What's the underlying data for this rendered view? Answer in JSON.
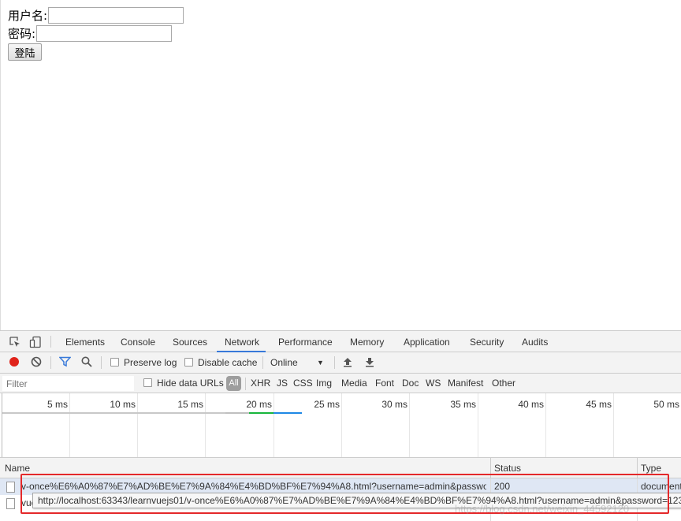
{
  "form": {
    "username_label": "用户名:",
    "username_value": "",
    "password_label": "密码:",
    "password_value": "",
    "login_button": "登陆"
  },
  "devtools": {
    "tabs": [
      "Elements",
      "Console",
      "Sources",
      "Network",
      "Performance",
      "Memory",
      "Application",
      "Security",
      "Audits"
    ],
    "active_tab": "Network",
    "toolbar": {
      "preserve_log": "Preserve log",
      "disable_cache": "Disable cache",
      "throttling": "Online"
    },
    "filter": {
      "placeholder": "Filter",
      "hide_data_urls": "Hide data URLs",
      "all": "All",
      "types": [
        "XHR",
        "JS",
        "CSS",
        "Img",
        "Media",
        "Font",
        "Doc",
        "WS",
        "Manifest",
        "Other"
      ]
    },
    "timeline": {
      "ticks": [
        "5 ms",
        "10 ms",
        "15 ms",
        "20 ms",
        "25 ms",
        "30 ms",
        "35 ms",
        "40 ms",
        "45 ms",
        "50 ms"
      ]
    },
    "table": {
      "columns": {
        "name": "Name",
        "status": "Status",
        "type": "Type"
      },
      "rows": [
        {
          "name": "v-once%E6%A0%87%E7%AD%BE%E7%9A%84%E4%BD%BF%E7%94%A8.html?username=admin&password=",
          "status": "200",
          "type": "document"
        },
        {
          "name": "vue.js",
          "status": "",
          "type": ""
        }
      ]
    },
    "tooltip": "http://localhost:63343/learnvuejs01/v-once%E6%A0%87%E7%AD%BE%E7%9A%84%E4%BD%BF%E7%94%A8.html?username=admin&password=123"
  },
  "watermark": "https://blog.csdn.net/weixin_44592120",
  "colors": {
    "record_button": "#e0231b",
    "accent": "#3879d9",
    "highlight_box": "#e4282a",
    "selected_row": "#dfe7f4"
  }
}
